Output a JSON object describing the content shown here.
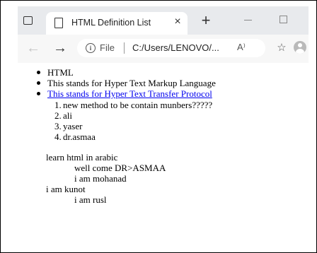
{
  "browser": {
    "tab_title": "HTML Definition List",
    "tab_close": "×",
    "new_tab": "+",
    "file_label": "File",
    "url": "C:/Users/LENOVO/...",
    "read_aloud": "A⁾"
  },
  "page": {
    "bullets": [
      {
        "text": "HTML",
        "link": false
      },
      {
        "text": "This stands for Hyper Text Markup Language",
        "link": false
      },
      {
        "text": "This stands for Hyper Text Transfer Protocol",
        "link": true
      }
    ],
    "numbered": [
      {
        "num": "1.",
        "text": "new method to be contain munbers?????"
      },
      {
        "num": "2.",
        "text": "ali"
      },
      {
        "num": "3.",
        "text": "yaser"
      },
      {
        "num": "4.",
        "text": "dr.asmaa"
      }
    ],
    "definitions": [
      {
        "term": "learn html in arabic",
        "descs": [
          "well come DR>ASMAA",
          "i am mohanad"
        ]
      },
      {
        "term": "i am kunot",
        "descs": [
          "i am rusl"
        ]
      }
    ]
  }
}
